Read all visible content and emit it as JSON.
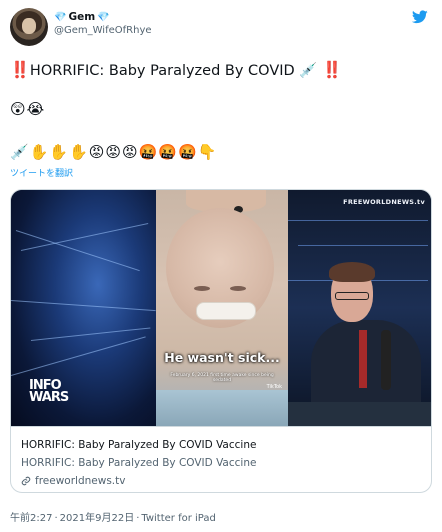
{
  "user": {
    "display_name": "Gem",
    "name_emoji_left": "💎",
    "name_emoji_right": "💎",
    "handle": "@Gem_WifeOfRhye"
  },
  "tweet": {
    "bang_left": "‼️",
    "headline": "HORRIFIC: Baby Paralyzed By COVID",
    "syringe": "💉",
    "bang_right": "‼️",
    "emoji_line_1": "😲😭",
    "emoji_line_2": "💉✋✋✋😡😡😡🤬🤬🤬👇",
    "translate_label": "ツイートを翻訳"
  },
  "card": {
    "media": {
      "caption": "He wasn't sick...",
      "subcaption": "February 6, 2021 first time awake since being sedated",
      "tiktok": "TikTok",
      "watermark": "FREEWORLDNEWS.tv",
      "infowars_line1": "INFO",
      "infowars_line2": "WARS"
    },
    "title": "HORRIFIC: Baby Paralyzed By COVID Vaccine",
    "description": "HORRIFIC: Baby Paralyzed By COVID Vaccine",
    "domain": "freeworldnews.tv"
  },
  "footer": {
    "time": "午前2:27",
    "separator": "·",
    "date": "2021年9月22日",
    "source": "Twitter for iPad"
  },
  "colors": {
    "link_blue": "#1d9bf0",
    "text_primary": "#0f1419",
    "text_secondary": "#536471",
    "border": "#cfd9de"
  }
}
